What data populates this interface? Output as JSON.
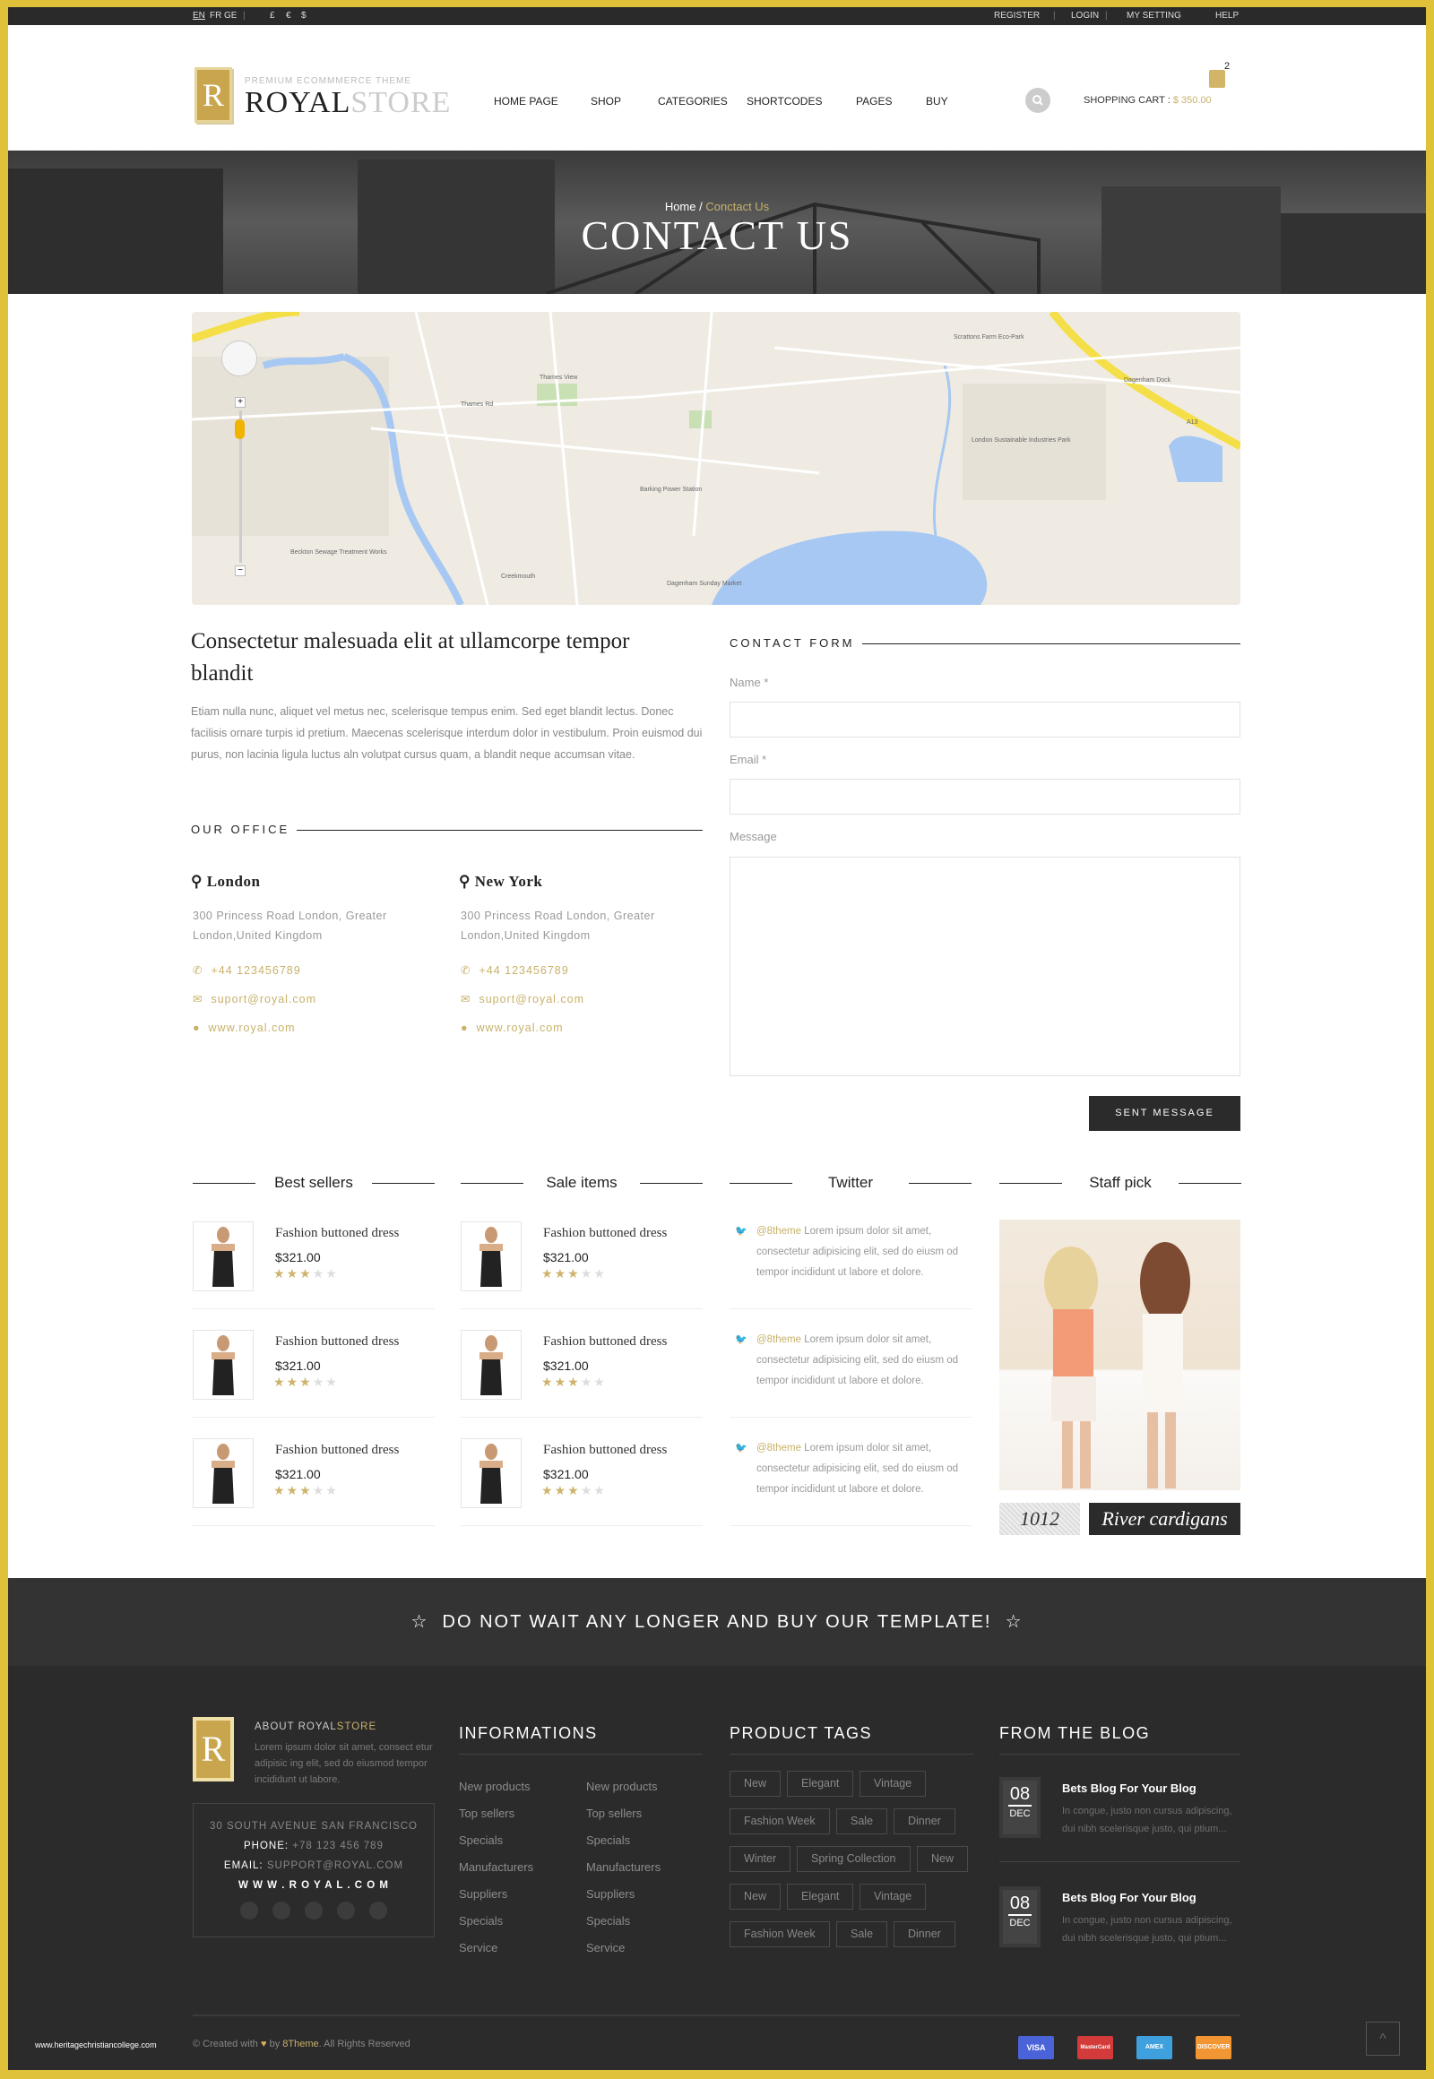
{
  "topbar": {
    "languages": [
      "EN",
      "FR",
      "GE"
    ],
    "currencies": [
      "£",
      "€",
      "$"
    ],
    "links": [
      "REGISTER",
      "LOGIN",
      "MY SETTING",
      "HELP"
    ]
  },
  "header": {
    "logo_letter": "R",
    "tagline": "PREMIUM ECOMMMERCE THEME",
    "brand_a": "ROYAL",
    "brand_b": "STORE",
    "nav": [
      "HOME PAGE",
      "SHOP",
      "CATEGORIES",
      "SHORTCODES",
      "PAGES",
      "BUY"
    ],
    "cart_label": "SHOPPING CART :",
    "cart_total": "$ 350.00",
    "cart_count": "2"
  },
  "hero": {
    "breadcrumb_home": "Home",
    "breadcrumb_sep": "/",
    "breadcrumb_current": "Conctact Us",
    "title": "CONTACT US"
  },
  "map": {
    "labels": [
      "Thames View",
      "Thames Rd",
      "Barking Power Station",
      "London Sustainable Industries Park",
      "Dagenham Dock",
      "Dagenham Sunday Market",
      "Creekmouth",
      "Beckton Sewage Treatment Works",
      "Scrattons Farm Eco-Park",
      "A13"
    ]
  },
  "intro": {
    "title": "Consectetur malesuada elit at ullamcorpe tempor blandit",
    "text": "Etiam nulla nunc, aliquet vel metus nec, scelerisque tempus enim. Sed eget blandit lectus. Donec facilisis ornare turpis id pretium. Maecenas scelerisque interdum dolor in vestibulum. Proin euismod dui purus, non lacinia ligula luctus aln volutpat cursus quam, a blandit neque accumsan vitae."
  },
  "office": {
    "heading": "OUR OFFICE",
    "locations": [
      {
        "city": "London",
        "address": "300 Princess Road London, Greater London,United Kingdom",
        "phone": "+44 123456789",
        "email": "suport@royal.com",
        "web": "www.royal.com"
      },
      {
        "city": "New York",
        "address": "300 Princess Road London, Greater London,United Kingdom",
        "phone": "+44 123456789",
        "email": "suport@royal.com",
        "web": "www.royal.com"
      }
    ]
  },
  "form": {
    "heading": "CONTACT FORM",
    "name_label": "Name",
    "email_label": "Email",
    "message_label": "Message",
    "required": "*",
    "submit": "SENT MESSAGE"
  },
  "widgets": {
    "best_sellers": {
      "title": "Best sellers",
      "items": [
        {
          "name": "Fashion buttoned dress",
          "price": "$321.00",
          "rating": 3
        },
        {
          "name": "Fashion buttoned dress",
          "price": "$321.00",
          "rating": 3
        },
        {
          "name": "Fashion buttoned dress",
          "price": "$321.00",
          "rating": 3
        }
      ]
    },
    "sale_items": {
      "title": "Sale items",
      "items": [
        {
          "name": "Fashion buttoned dress",
          "price": "$321.00",
          "rating": 3
        },
        {
          "name": "Fashion buttoned dress",
          "price": "$321.00",
          "rating": 3
        },
        {
          "name": "Fashion buttoned dress",
          "price": "$321.00",
          "rating": 3
        }
      ]
    },
    "twitter": {
      "title": "Twitter",
      "tweets": [
        {
          "handle": "@8theme",
          "text": "Lorem ipsum dolor sit amet, consectetur adipisicing elit, sed do eiusm od tempor incididunt ut labore et dolore."
        },
        {
          "handle": "@8theme",
          "text": "Lorem ipsum dolor sit amet, consectetur adipisicing elit, sed do eiusm od tempor incididunt ut labore et dolore."
        },
        {
          "handle": "@8theme",
          "text": "Lorem ipsum dolor sit amet, consectetur adipisicing elit, sed do eiusm od tempor incididunt ut labore et dolore."
        }
      ]
    },
    "staff_pick": {
      "title": "Staff pick",
      "number": "1012",
      "caption": "River cardigans"
    }
  },
  "banner": {
    "text": "DO NOT WAIT ANY LONGER AND BUY OUR TEMPLATE!"
  },
  "footer": {
    "about": {
      "title_a": "ABOUT ROYAL",
      "title_b": "STORE",
      "text": "Lorem ipsum dolor sit amet, consect etur adipisic ing elit, sed do eiusmod tempor incididunt ut labore.",
      "address": "30 SOUTH AVENUE SAN FRANCISCO",
      "phone_label": "PHONE:",
      "phone": "+78 123 456 789",
      "email_label": "EMAIL:",
      "email": "SUPPORT@ROYAL.COM",
      "web": "W W W . R O Y A L . C O M",
      "social": [
        "twitter",
        "facebook",
        "pinterest",
        "google-plus",
        "rss"
      ]
    },
    "informations": {
      "title": "INFORMATIONS",
      "col1": [
        "New products",
        "Top sellers",
        "Specials",
        "Manufacturers",
        "Suppliers",
        "Specials",
        "Service"
      ],
      "col2": [
        "New products",
        "Top sellers",
        "Specials",
        "Manufacturers",
        "Suppliers",
        "Specials",
        "Service"
      ]
    },
    "tags": {
      "title": "PRODUCT TAGS",
      "rows": [
        [
          "New",
          "Elegant",
          "Vintage"
        ],
        [
          "Fashion Week",
          "Sale",
          "Dinner"
        ],
        [
          "Winter",
          "Spring Collection",
          "New"
        ],
        [
          "New",
          "Elegant",
          "Vintage"
        ],
        [
          "Fashion Week",
          "Sale",
          "Dinner"
        ]
      ]
    },
    "blog": {
      "title": "FROM THE BLOG",
      "posts": [
        {
          "day": "08",
          "month": "DEC",
          "title": "Bets Blog For Your Blog",
          "excerpt": "In congue, justo non cursus adipiscing, dui nibh scelerisque justo, qui ptium..."
        },
        {
          "day": "08",
          "month": "DEC",
          "title": "Bets Blog For Your Blog",
          "excerpt": "In congue, justo non cursus adipiscing, dui nibh scelerisque justo, qui ptium..."
        }
      ]
    },
    "watermark": "www.heritagechristiancollege.com",
    "copyright_a": "© Created with",
    "copyright_by": "by",
    "copyright_brand": "8Theme",
    "copyright_b": "All Rights Reserved",
    "payments": [
      "VISA",
      "MasterCard",
      "AMEX",
      "DISCOVER"
    ]
  },
  "colors": {
    "accent": "#c8b16a",
    "dark": "#2b2b2b",
    "border": "#e0c23a"
  }
}
